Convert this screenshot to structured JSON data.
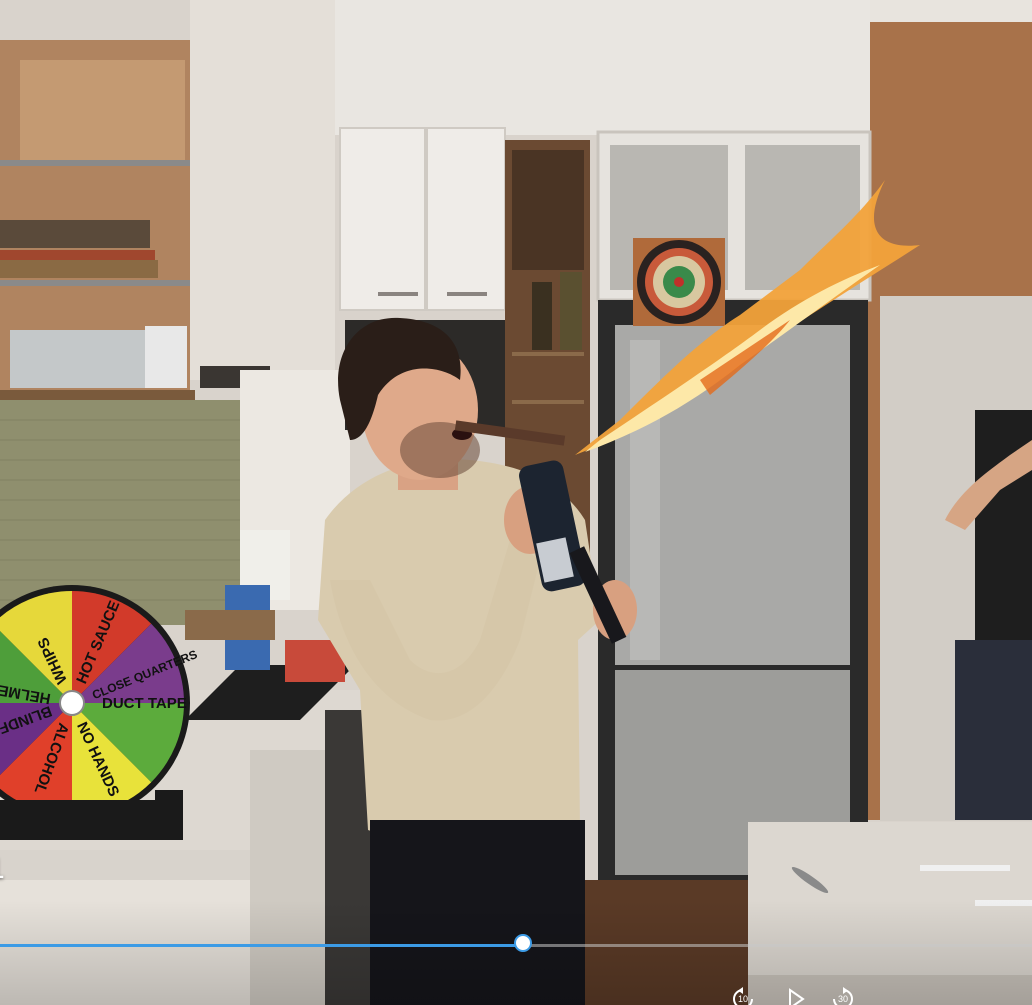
{
  "player": {
    "current_time_fragment": "1",
    "progress_fraction": 0.507,
    "accent_color": "#3c9be6"
  },
  "controls": {
    "skip_back_label": "10",
    "play_icon": "play-icon",
    "skip_forward_label": "30"
  },
  "scene": {
    "wheel_segments": [
      "HOT SAUCE",
      "CLOSE QUARTERS",
      "DUCT TAPE",
      "NO HANDS",
      "ALCOHOL",
      "BLINDFOLD",
      "HELMET",
      "WHIPS"
    ],
    "wheel_colors": [
      "#d23a2a",
      "#7a3c8c",
      "#5cab3c",
      "#e8e23a",
      "#e0402a",
      "#6a2f86",
      "#4e9e3a",
      "#e6d83a"
    ]
  }
}
